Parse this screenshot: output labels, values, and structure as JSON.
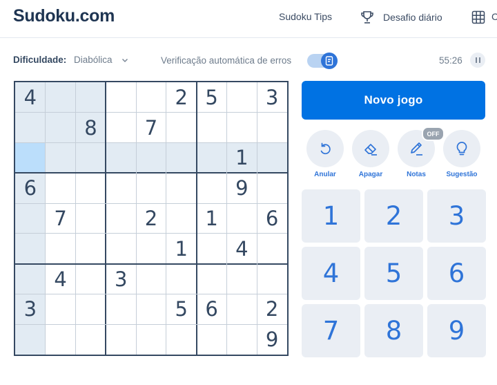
{
  "header": {
    "logo": "Sudoku.com",
    "nav_tips": "Sudoku Tips",
    "nav_daily": "Desafio diário",
    "nav_cut": "C"
  },
  "toolbar": {
    "difficulty_label": "Dificuldade:",
    "difficulty_value": "Diabólica",
    "auto_check_label": "Verificação automática de erros",
    "auto_check_on": true,
    "timer": "55:26"
  },
  "board": {
    "cells": [
      [
        "4",
        "",
        "",
        "",
        "",
        "2",
        "5",
        "",
        "3"
      ],
      [
        "",
        "",
        "8",
        "",
        "7",
        "",
        "",
        "",
        ""
      ],
      [
        "",
        "",
        "",
        "",
        "",
        "",
        "",
        "1",
        ""
      ],
      [
        "6",
        "",
        "",
        "",
        "",
        "",
        "",
        "9",
        ""
      ],
      [
        "",
        "7",
        "",
        "",
        "2",
        "",
        "1",
        "",
        "6"
      ],
      [
        "",
        "",
        "",
        "",
        "",
        "1",
        "",
        "4",
        ""
      ],
      [
        "",
        "4",
        "",
        "3",
        "",
        "",
        "",
        "",
        ""
      ],
      [
        "3",
        "",
        "",
        "",
        "",
        "5",
        "6",
        "",
        "2"
      ],
      [
        "",
        "",
        "",
        "",
        "",
        "",
        "",
        "",
        "9"
      ]
    ],
    "selected": [
      2,
      0
    ],
    "colors": {
      "highlight": "#e2ebf3",
      "selected": "#bbdefb",
      "given": "#344861"
    }
  },
  "panel": {
    "new_game": "Novo jogo",
    "actions": [
      {
        "label": "Anular",
        "icon": "undo-icon"
      },
      {
        "label": "Apagar",
        "icon": "eraser-icon"
      },
      {
        "label": "Notas",
        "icon": "pencil-icon",
        "badge": "OFF"
      },
      {
        "label": "Sugestão",
        "icon": "lightbulb-icon"
      }
    ],
    "numbers": [
      "1",
      "2",
      "3",
      "4",
      "5",
      "6",
      "7",
      "8",
      "9"
    ],
    "accent": "#0072e3"
  }
}
